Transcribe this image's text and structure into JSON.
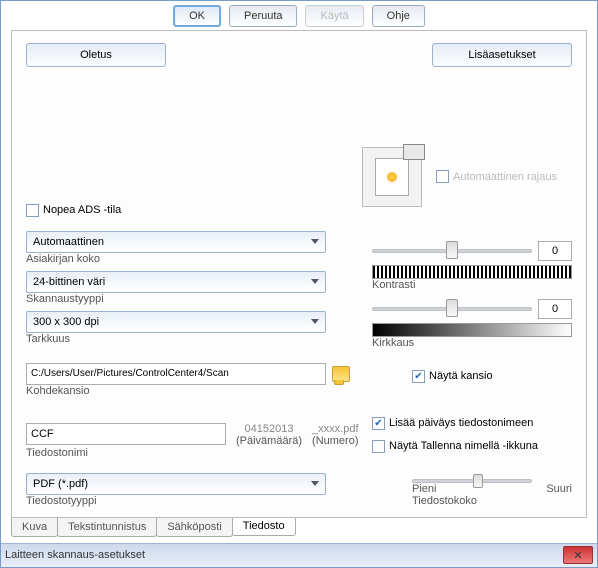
{
  "window": {
    "title": "Laitteen skannaus-asetukset"
  },
  "dialog_buttons": {
    "ok": "OK",
    "cancel": "Peruuta",
    "apply": "Käytä",
    "help": "Ohje"
  },
  "tabs": {
    "kuva": "Kuva",
    "tekstin": "Tekstintunnistus",
    "sahkoposti": "Sähköposti",
    "tiedosto": "Tiedosto"
  },
  "filetype": {
    "label": "Tiedostotyyppi",
    "value": "PDF (*.pdf)"
  },
  "filesize": {
    "label": "Tiedostokoko",
    "small": "Pieni",
    "large": "Suuri"
  },
  "filename": {
    "label": "Tiedostonimi",
    "value": "CCF",
    "date_label": "(Päivämäärä)",
    "date_value": "04152013",
    "num_label": "(Numero)",
    "num_suffix": "_xxxx.pdf"
  },
  "show_saveas": {
    "label": "Näytä Tallenna nimellä -ikkuna"
  },
  "add_date": {
    "label": "Lisää päiväys tiedostonimeen"
  },
  "dest": {
    "label": "Kohdekansio",
    "path": "C:/Users/User/Pictures/ControlCenter4/Scan"
  },
  "show_folder": {
    "label": "Näytä kansio"
  },
  "resolution": {
    "label": "Tarkkuus",
    "value": "300 x 300 dpi"
  },
  "scantype": {
    "label": "Skannaustyyppi",
    "value": "24-bittinen väri"
  },
  "docsize": {
    "label": "Asiakirjan koko",
    "value": "Automaattinen"
  },
  "fast_adf": {
    "label": "Nopea ADS -tila"
  },
  "brightness": {
    "label": "Kirkkaus",
    "value": "0"
  },
  "contrast": {
    "label": "Kontrasti",
    "value": "0"
  },
  "autocrop": {
    "label": "Automaattinen rajaus"
  },
  "buttons": {
    "default": "Oletus",
    "advanced": "Lisäasetukset"
  }
}
